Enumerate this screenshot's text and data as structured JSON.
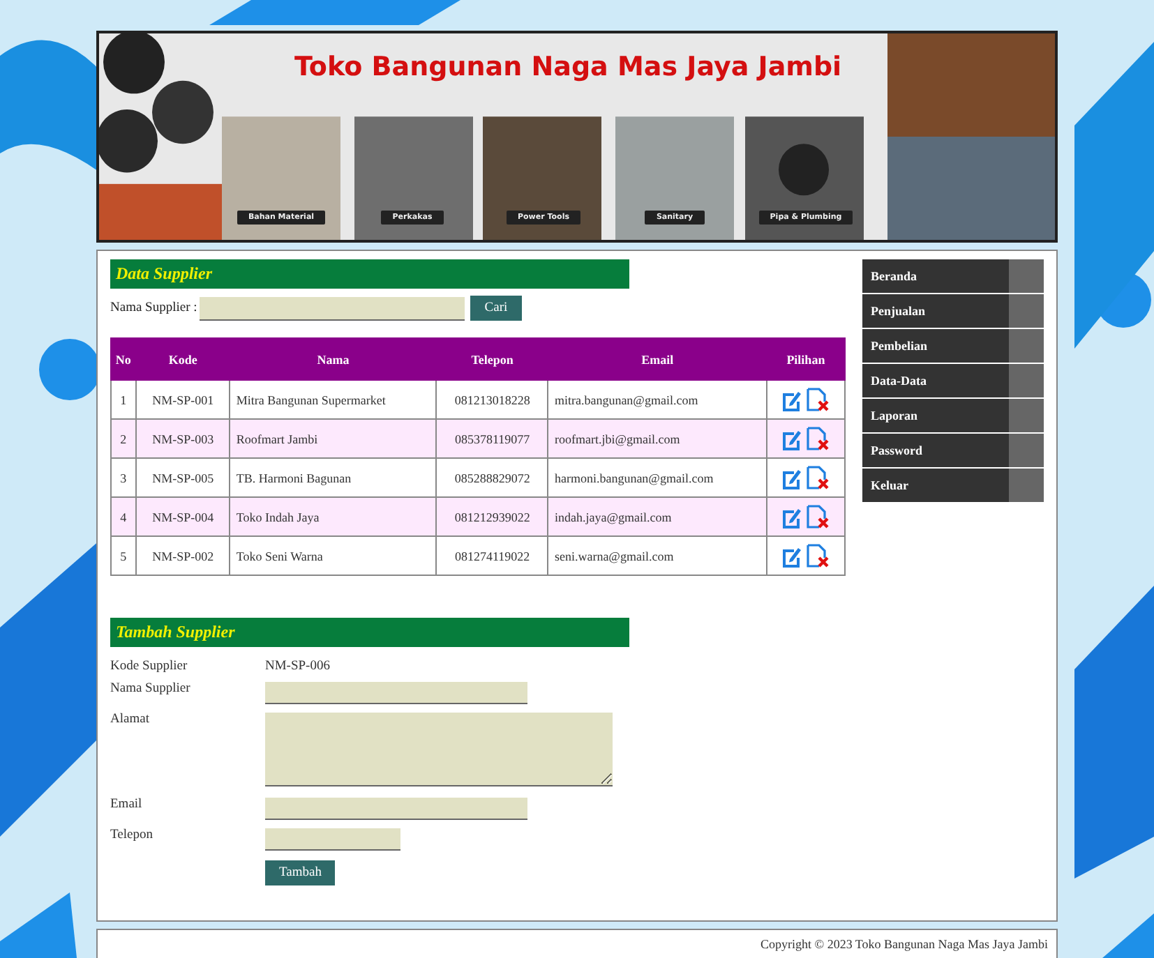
{
  "banner": {
    "title": "Toko Bangunan Naga Mas Jaya Jambi",
    "categories": [
      "Bahan Material",
      "Perkakas",
      "Power Tools",
      "Sanitary",
      "Pipa & Plumbing"
    ]
  },
  "supplier_list": {
    "heading": "Data Supplier",
    "search": {
      "label": "Nama Supplier :",
      "button": "Cari"
    },
    "columns": [
      "No",
      "Kode",
      "Nama",
      "Telepon",
      "Email",
      "Pilihan"
    ],
    "rows": [
      {
        "no": "1",
        "kode": "NM-SP-001",
        "nama": "Mitra Bangunan Supermarket",
        "telepon": "081213018228",
        "email": "mitra.bangunan@gmail.com"
      },
      {
        "no": "2",
        "kode": "NM-SP-003",
        "nama": "Roofmart Jambi",
        "telepon": "085378119077",
        "email": "roofmart.jbi@gmail.com"
      },
      {
        "no": "3",
        "kode": "NM-SP-005",
        "nama": "TB. Harmoni Bagunan",
        "telepon": "085288829072",
        "email": "harmoni.bangunan@gmail.com"
      },
      {
        "no": "4",
        "kode": "NM-SP-004",
        "nama": "Toko Indah Jaya",
        "telepon": "081212939022",
        "email": "indah.jaya@gmail.com"
      },
      {
        "no": "5",
        "kode": "NM-SP-002",
        "nama": "Toko Seni Warna",
        "telepon": "081274119022",
        "email": "seni.warna@gmail.com"
      }
    ]
  },
  "add_form": {
    "heading": "Tambah Supplier",
    "fields": [
      {
        "label": "Kode Supplier",
        "kind": "static",
        "value": "NM-SP-006"
      },
      {
        "label": "Nama Supplier",
        "kind": "input"
      },
      {
        "label": "Alamat",
        "kind": "textarea"
      },
      {
        "label": "Email",
        "kind": "input"
      },
      {
        "label": "Telepon",
        "kind": "short"
      }
    ],
    "button": "Tambah"
  },
  "menu": [
    "Beranda",
    "Penjualan",
    "Pembelian",
    "Data-Data",
    "Laporan",
    "Password",
    "Keluar"
  ],
  "footer": "Copyright © 2023 Toko Bangunan Naga Mas Jaya Jambi"
}
